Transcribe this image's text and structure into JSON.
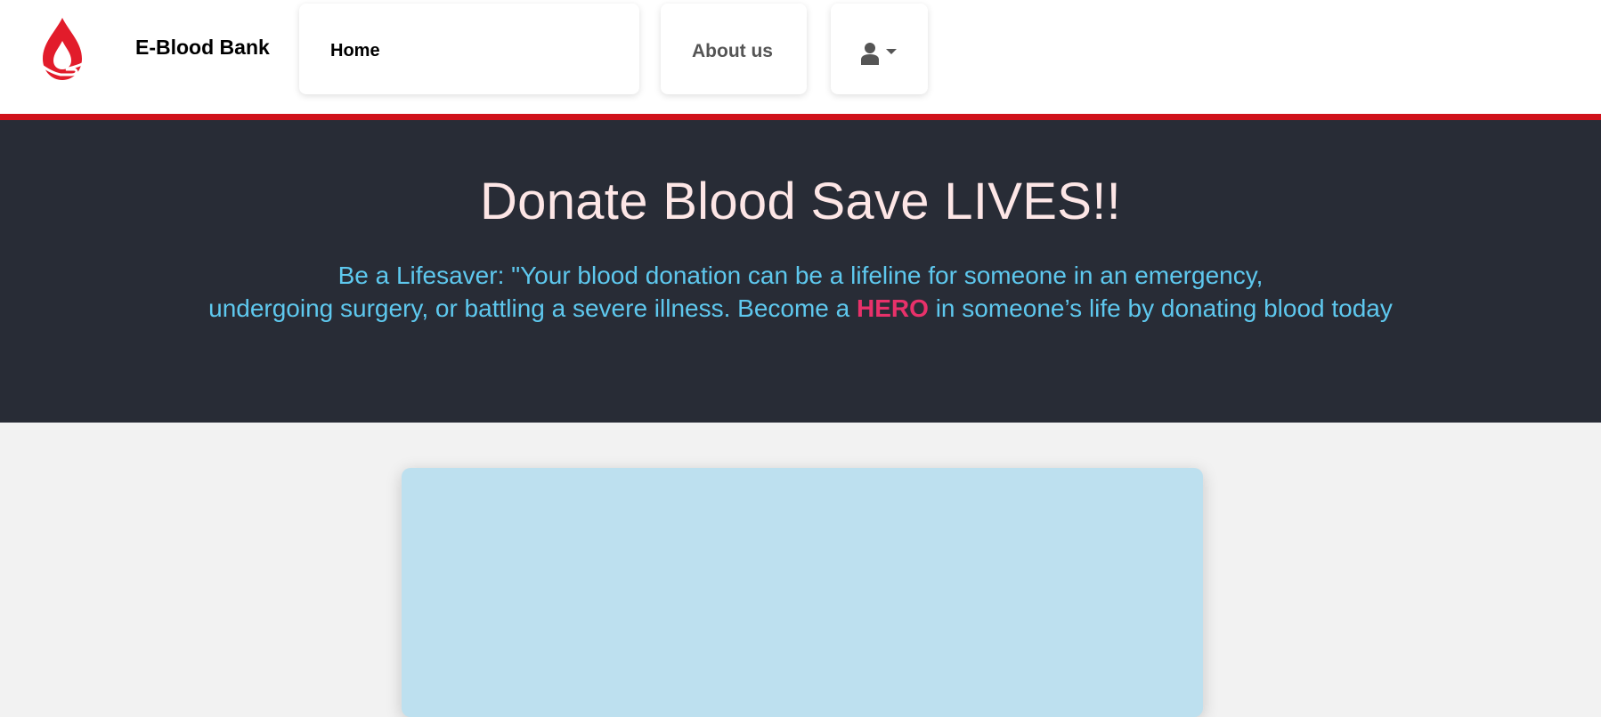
{
  "navbar": {
    "brand": "E-Blood Bank",
    "logo_icon": "blood-drop-hand-icon",
    "items": [
      {
        "label": "Home"
      },
      {
        "label": "About us"
      }
    ],
    "user_menu_icon": "user-icon",
    "user_menu_caret": "caret-down-icon"
  },
  "hero": {
    "title": "Donate Blood Save LIVES!!",
    "subtitle_line1": "Be a Lifesaver: \"Your blood donation can be a lifeline for someone in an emergency,",
    "subtitle_line2_before": "undergoing surgery, or battling a severe illness. Become a ",
    "subtitle_highlight": "HERO",
    "subtitle_line2_after": " in someone’s life by donating blood today"
  },
  "colors": {
    "accent_red": "#d0111b",
    "hero_bg": "#282c36",
    "hero_title": "#fde6e6",
    "hero_subtitle": "#5ec8ee",
    "highlight": "#e8316a",
    "card_bg": "#bde0ef"
  }
}
